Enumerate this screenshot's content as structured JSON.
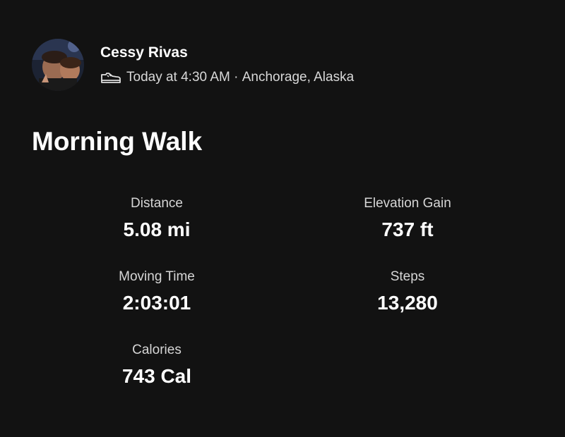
{
  "athlete": {
    "name": "Cessy Rivas",
    "avatar_icon": "profile-photo",
    "activity_icon": "shoe-icon",
    "date": "Today at 4:30 AM",
    "separator": " · ",
    "location": "Anchorage, Alaska"
  },
  "activity": {
    "title": "Morning Walk"
  },
  "stats": {
    "distance": {
      "label": "Distance",
      "value": "5.08 mi"
    },
    "elevation": {
      "label": "Elevation Gain",
      "value": "737 ft"
    },
    "moving_time": {
      "label": "Moving Time",
      "value": "2:03:01"
    },
    "steps": {
      "label": "Steps",
      "value": "13,280"
    },
    "calories": {
      "label": "Calories",
      "value": "743 Cal"
    }
  },
  "colors": {
    "background": "#121212",
    "text_primary": "#ffffff",
    "text_secondary": "#d6d6d6"
  }
}
